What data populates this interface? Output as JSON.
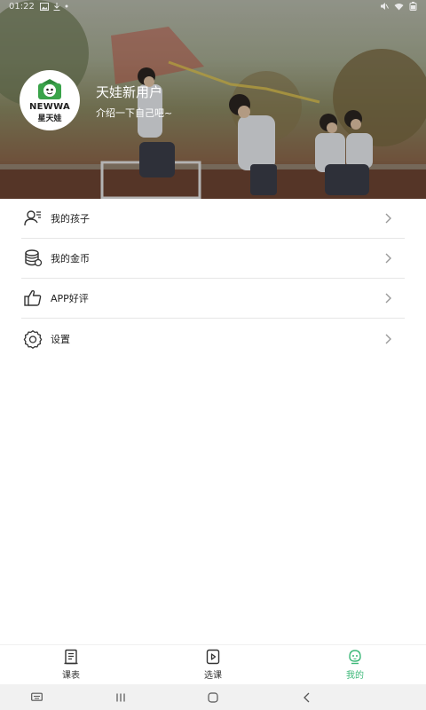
{
  "status_bar": {
    "time": "01:22"
  },
  "profile": {
    "avatar_logo_en": "NEWWA",
    "avatar_logo_cn": "星天娃",
    "name": "天娃新用户",
    "bio": "介绍一下自己吧~"
  },
  "menu": {
    "items": [
      {
        "label": "我的孩子",
        "icon": "child-user-icon"
      },
      {
        "label": "我的金币",
        "icon": "coins-icon"
      },
      {
        "label": "APP好评",
        "icon": "thumbs-up-icon"
      },
      {
        "label": "设置",
        "icon": "gear-icon"
      }
    ]
  },
  "tabbar": {
    "tabs": [
      {
        "label": "课表",
        "icon": "schedule-icon",
        "active": false
      },
      {
        "label": "选课",
        "icon": "play-course-icon",
        "active": false
      },
      {
        "label": "我的",
        "icon": "profile-face-icon",
        "active": true
      }
    ],
    "active_color": "#3cb878"
  }
}
